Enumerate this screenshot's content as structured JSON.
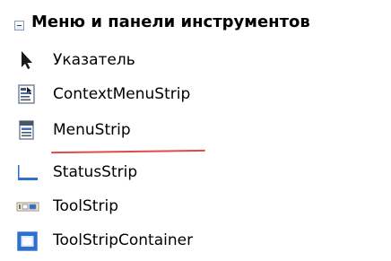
{
  "group": {
    "title": "Меню и панели инструментов",
    "expanded": true
  },
  "items": [
    {
      "label": "Указатель",
      "icon": "pointer-arrow-icon"
    },
    {
      "label": "ContextMenuStrip",
      "icon": "context-menu-strip-icon"
    },
    {
      "label": "MenuStrip",
      "icon": "menu-strip-icon"
    },
    {
      "label": "StatusStrip",
      "icon": "status-strip-icon"
    },
    {
      "label": "ToolStrip",
      "icon": "tool-strip-icon"
    },
    {
      "label": "ToolStripContainer",
      "icon": "tool-strip-container-icon"
    }
  ],
  "colors": {
    "annotation_underline": "#e24a4a",
    "icon_blue": "#2f6fd1",
    "icon_border": "#6b7c93"
  }
}
